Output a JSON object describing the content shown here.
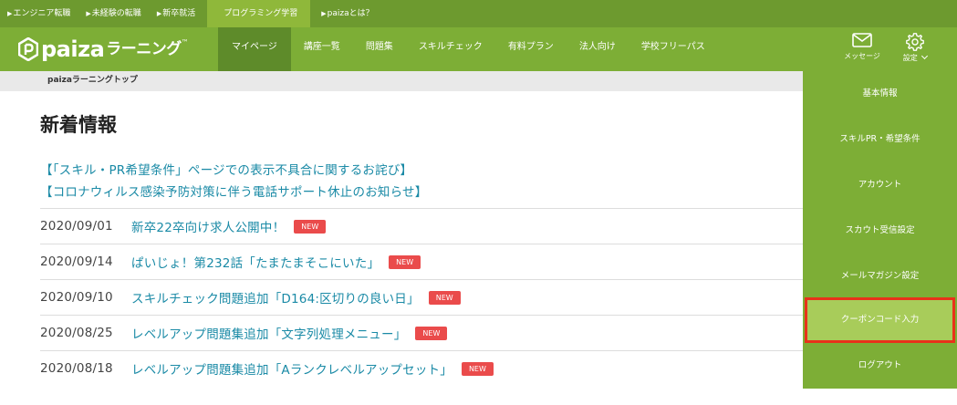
{
  "topbar": {
    "links": [
      {
        "label": "エンジニア転職"
      },
      {
        "label": "未経験の転職"
      },
      {
        "label": "新卒就活"
      },
      {
        "label": "プログラミング学習"
      },
      {
        "label": "paizaとは？"
      }
    ]
  },
  "logo": {
    "brand": "paiza",
    "sub": "ラーニング",
    "tm": "™"
  },
  "nav": {
    "items": [
      "マイページ",
      "講座一覧",
      "問題集",
      "スキルチェック",
      "有料プラン",
      "法人向け",
      "学校フリーパス"
    ],
    "message_label": "メッセージ",
    "settings_label": "設定"
  },
  "breadcrumb": {
    "current": "paizaラーニングトップ"
  },
  "main": {
    "title": "新着情報",
    "notices": [
      "【「スキル・PR希望条件」ページでの表示不具合に関するお詫び】",
      "【コロナウィルス感染予防対策に伴う電話サポート休止のお知らせ】"
    ],
    "news": [
      {
        "date": "2020/09/01",
        "text": "新卒22卒向け求人公開中！",
        "badge": "NEW"
      },
      {
        "date": "2020/09/14",
        "text": "ぱいじょ！第232話「たまたまそこにいた」",
        "badge": "NEW"
      },
      {
        "date": "2020/09/10",
        "text": "スキルチェック問題追加「D164:区切りの良い日」",
        "badge": "NEW"
      },
      {
        "date": "2020/08/25",
        "text": "レベルアップ問題集追加「文字列処理メニュー」",
        "badge": "NEW"
      },
      {
        "date": "2020/08/18",
        "text": "レベルアップ問題集追加「Aランクレベルアップセット」",
        "badge": "NEW"
      }
    ]
  },
  "settings_menu": {
    "items": [
      "基本情報",
      "スキルPR・希望条件",
      "アカウント",
      "スカウト受信設定",
      "メールマガジン設定",
      "クーポンコード入力",
      "ログアウト"
    ],
    "highlighted": "クーポンコード入力"
  },
  "colors": {
    "nav": "#7dae36",
    "topbar": "#6d9a2f",
    "active": "#5e8b2a",
    "link": "#1a8aa6",
    "badge": "#ea4b4b",
    "highlight_border": "#e8321a"
  }
}
